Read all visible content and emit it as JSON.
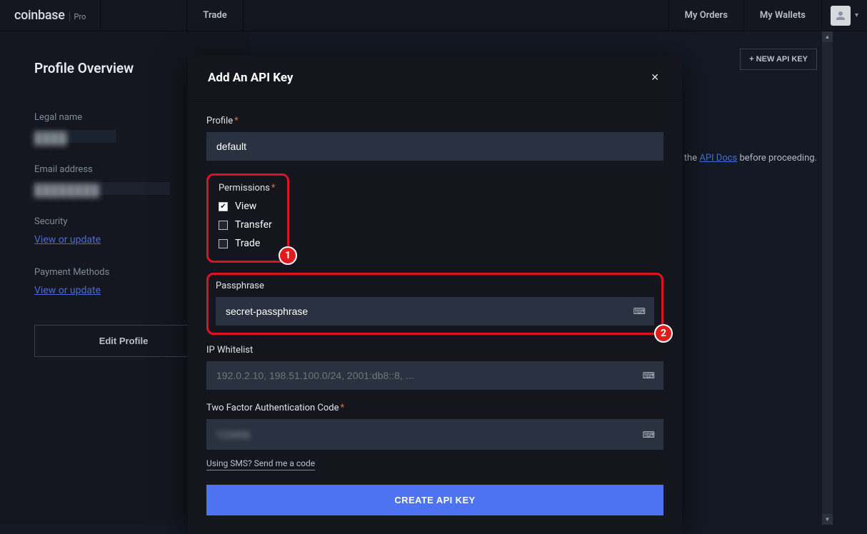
{
  "brand": {
    "main": "coinbase",
    "sub": "Pro"
  },
  "nav": {
    "trade": "Trade",
    "my_orders": "My Orders",
    "my_wallets": "My Wallets"
  },
  "sidebar": {
    "title": "Profile Overview",
    "legal_name_label": "Legal name",
    "email_label": "Email address",
    "security_label": "Security",
    "payment_label": "Payment Methods",
    "view_update": "View or update",
    "edit_profile": "Edit Profile"
  },
  "content": {
    "new_api_key": "+ NEW API KEY",
    "docs_prefix": "Read the ",
    "docs_link": "API Docs",
    "docs_suffix": " before proceeding."
  },
  "modal": {
    "title": "Add An API Key",
    "profile_label": "Profile",
    "profile_value": "default",
    "permissions_label": "Permissions",
    "perm_view": "View",
    "perm_transfer": "Transfer",
    "perm_trade": "Trade",
    "passphrase_label": "Passphrase",
    "passphrase_value": "secret-passphrase",
    "ip_label": "IP Whitelist",
    "ip_placeholder": "192.0.2.10, 198.51.100.0/24, 2001:db8::8, ...",
    "tfa_label": "Two Factor Authentication Code",
    "tfa_value": "123456",
    "sms_link": "Using SMS? Send me a code",
    "create_button": "CREATE API KEY"
  },
  "annotations": {
    "one": "1",
    "two": "2"
  }
}
